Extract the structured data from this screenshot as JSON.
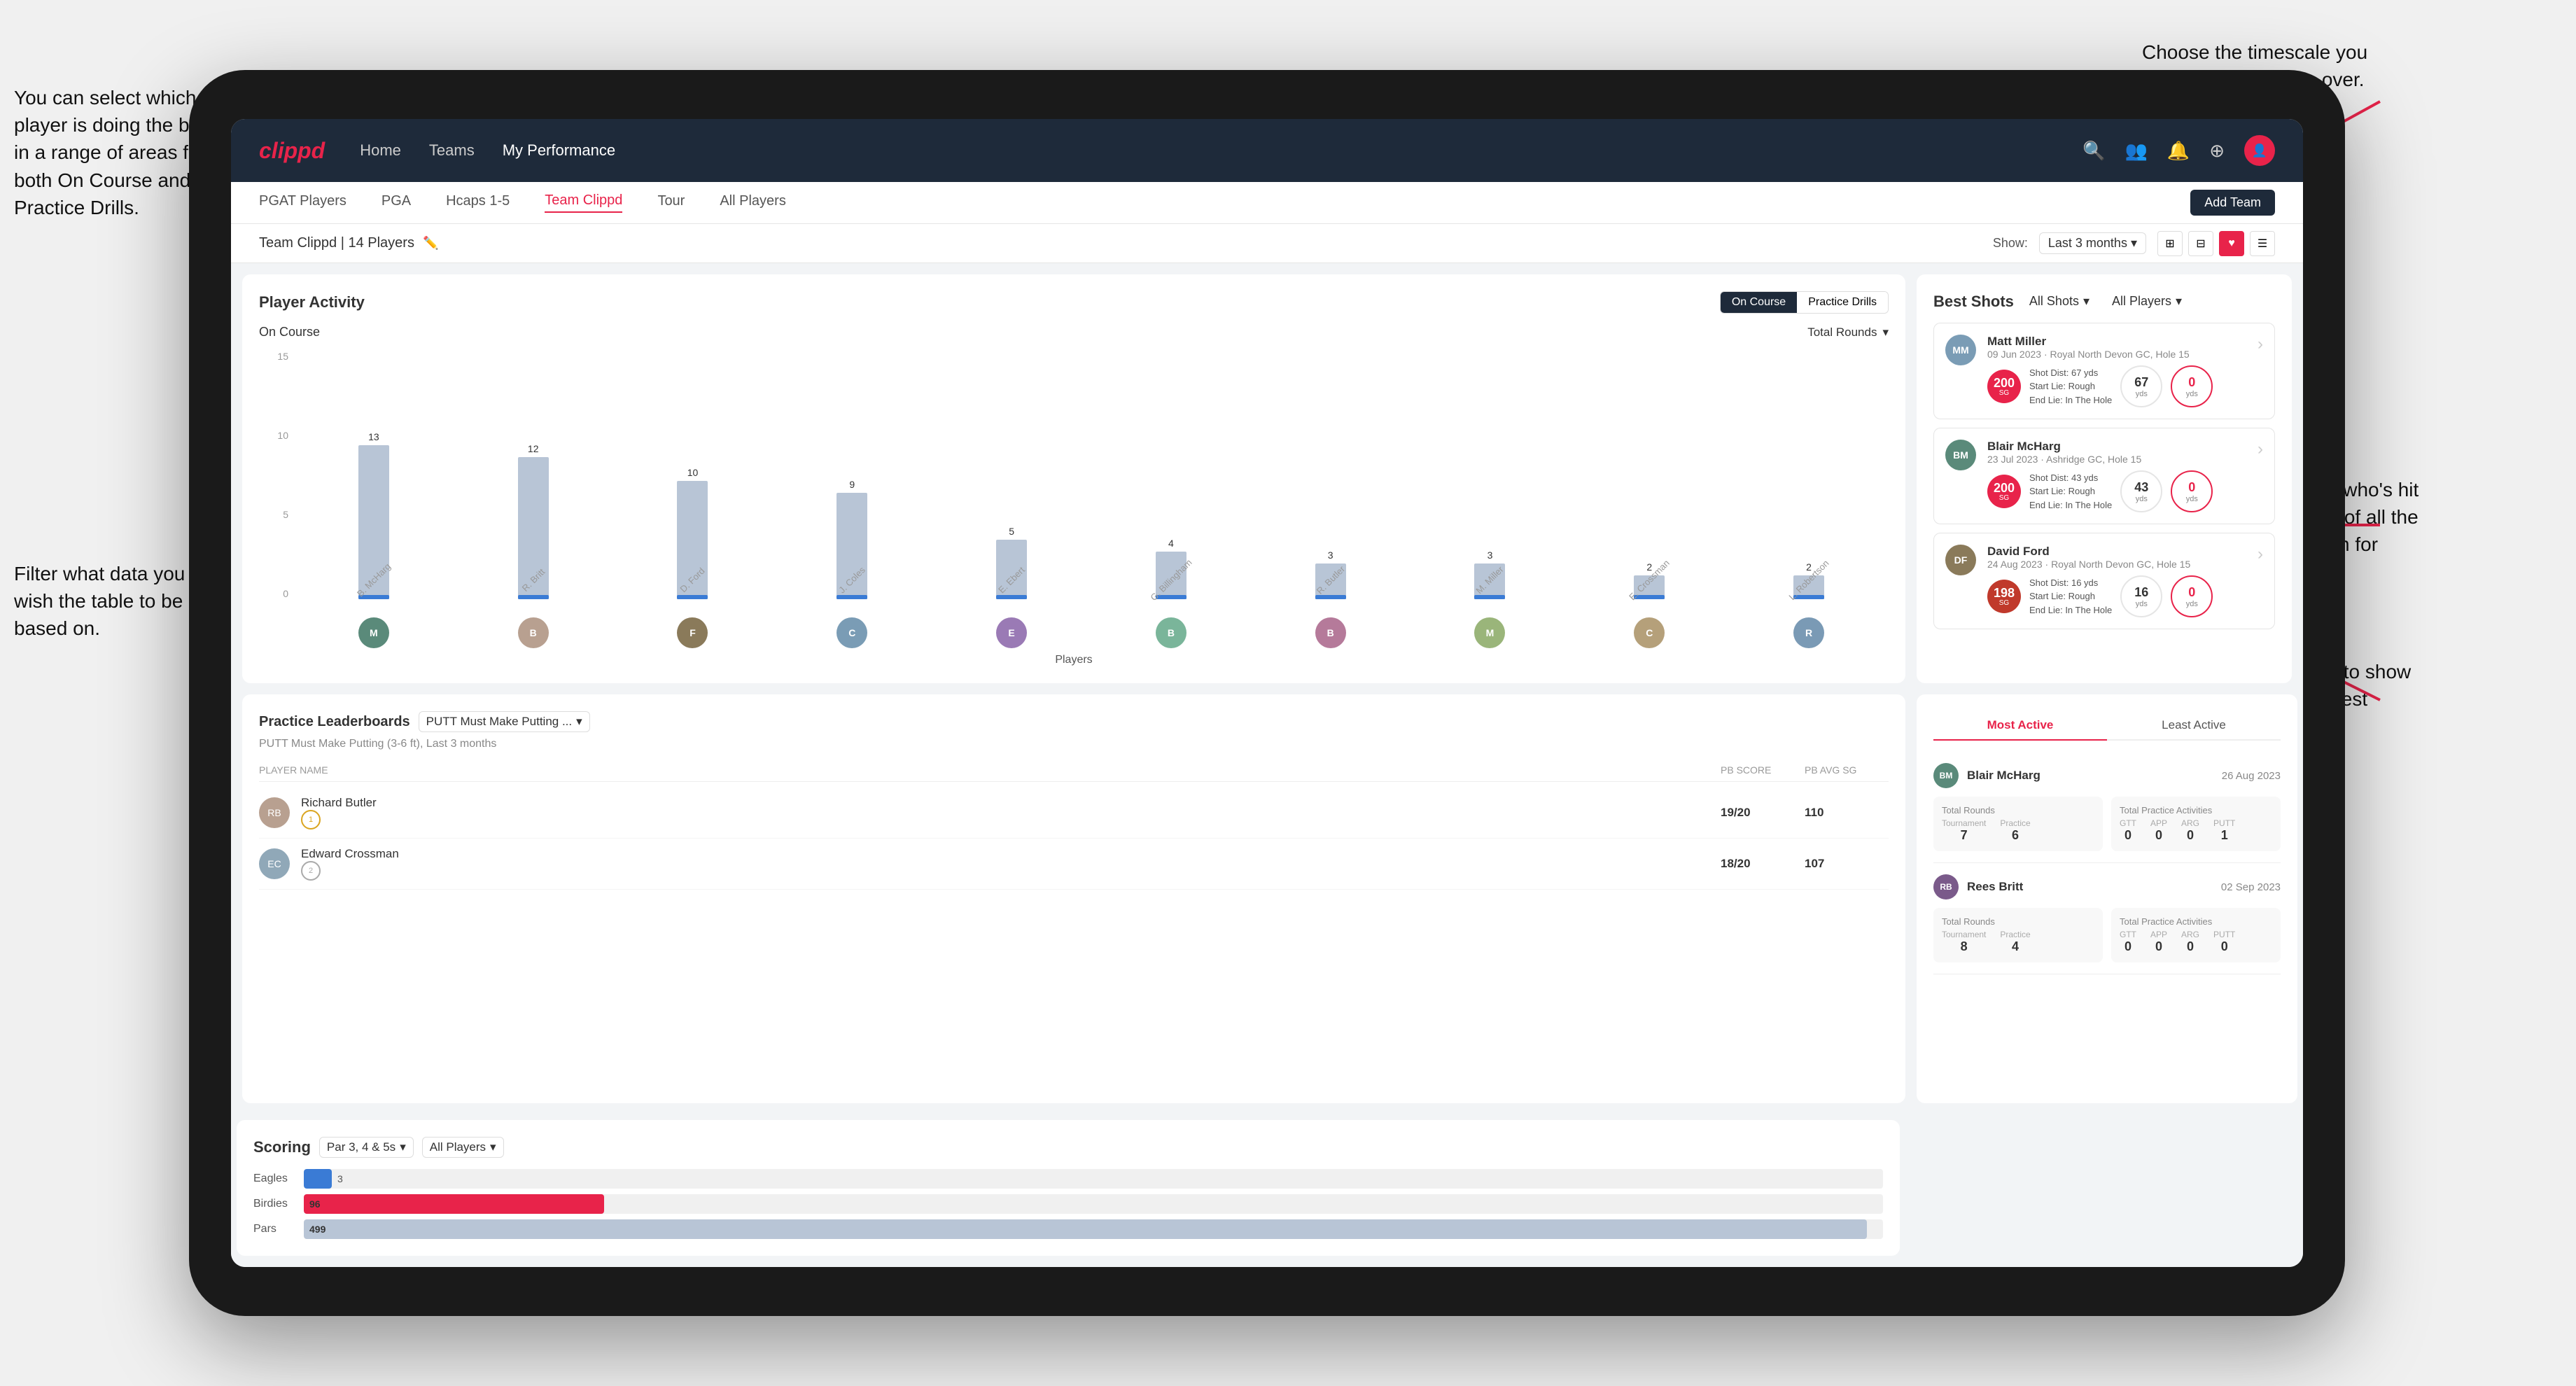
{
  "annotations": {
    "top_right": "Choose the timescale you wish to see the data over.",
    "left_top": "You can select which player is doing the best in a range of areas for both On Course and Practice Drills.",
    "left_bottom": "Filter what data you wish the table to be based on.",
    "right_mid": "Here you can see who's hit the best shots out of all the players in the team for each department.",
    "right_bottom": "You can also filter to show just one player's best shots."
  },
  "nav": {
    "logo": "clippd",
    "items": [
      "Home",
      "Teams",
      "My Performance"
    ],
    "icons": [
      "🔍",
      "👤",
      "🔔",
      "⊕",
      "👤"
    ]
  },
  "sub_nav": {
    "items": [
      "PGAT Players",
      "PGA",
      "Hcaps 1-5",
      "Team Clippd",
      "Tour",
      "All Players"
    ],
    "active": "Team Clippd",
    "add_button": "Add Team"
  },
  "team_header": {
    "title": "Team Clippd | 14 Players",
    "show_label": "Show:",
    "show_value": "Last 3 months",
    "view_icons": [
      "grid4",
      "grid2",
      "heart",
      "list"
    ]
  },
  "player_activity": {
    "title": "Player Activity",
    "toggle_options": [
      "On Course",
      "Practice Drills"
    ],
    "active_toggle": "On Course",
    "section_label": "On Course",
    "dropdown_label": "Total Rounds",
    "y_labels": [
      "0",
      "5",
      "10",
      "15"
    ],
    "y_axis_title": "Total Rounds",
    "bars": [
      {
        "player": "B. McHarg",
        "value": 13,
        "color": "#b8c5d6"
      },
      {
        "player": "R. Britt",
        "value": 12,
        "color": "#b8c5d6"
      },
      {
        "player": "D. Ford",
        "value": 10,
        "color": "#b8c5d6"
      },
      {
        "player": "J. Coles",
        "value": 9,
        "color": "#b8c5d6"
      },
      {
        "player": "E. Ebert",
        "value": 5,
        "color": "#b8c5d6"
      },
      {
        "player": "G. Billingham",
        "value": 4,
        "color": "#b8c5d6"
      },
      {
        "player": "R. Butler",
        "value": 3,
        "color": "#b8c5d6"
      },
      {
        "player": "M. Miller",
        "value": 3,
        "color": "#b8c5d6"
      },
      {
        "player": "E. Crossman",
        "value": 2,
        "color": "#b8c5d6"
      },
      {
        "player": "L. Robertson",
        "value": 2,
        "color": "#b8c5d6"
      }
    ],
    "x_axis_title": "Players"
  },
  "best_shots": {
    "title": "Best Shots",
    "filters": [
      "All Shots",
      "All Players"
    ],
    "players": [
      {
        "name": "Matt Miller",
        "date": "09 Jun 2023",
        "course": "Royal North Devon GC",
        "hole": "Hole 15",
        "badge_num": "200",
        "badge_label": "SG",
        "shot_dist": "67 yds",
        "start_lie": "Rough",
        "end_lie": "In The Hole",
        "stat1_val": "67",
        "stat1_unit": "yds",
        "stat2_val": "0",
        "stat2_unit": "yds"
      },
      {
        "name": "Blair McHarg",
        "date": "23 Jul 2023",
        "course": "Ashridge GC",
        "hole": "Hole 15",
        "badge_num": "200",
        "badge_label": "SG",
        "shot_dist": "43 yds",
        "start_lie": "Rough",
        "end_lie": "In The Hole",
        "stat1_val": "43",
        "stat1_unit": "yds",
        "stat2_val": "0",
        "stat2_unit": "yds"
      },
      {
        "name": "David Ford",
        "date": "24 Aug 2023",
        "course": "Royal North Devon GC",
        "hole": "Hole 15",
        "badge_num": "198",
        "badge_label": "SG",
        "shot_dist": "16 yds",
        "start_lie": "Rough",
        "end_lie": "In The Hole",
        "stat1_val": "16",
        "stat1_unit": "yds",
        "stat2_val": "0",
        "stat2_unit": "yds"
      }
    ]
  },
  "practice_leaderboards": {
    "title": "Practice Leaderboards",
    "drill_label": "PUTT Must Make Putting ...",
    "sub_label": "PUTT Must Make Putting (3-6 ft), Last 3 months",
    "columns": [
      "PLAYER NAME",
      "PB SCORE",
      "PB AVG SG"
    ],
    "players": [
      {
        "rank": 1,
        "rank_type": "gold",
        "name": "Richard Butler",
        "score": "19/20",
        "avg_sg": "110"
      },
      {
        "rank": 2,
        "rank_type": "silver",
        "name": "Edward Crossman",
        "score": "18/20",
        "avg_sg": "107"
      }
    ]
  },
  "most_active": {
    "tabs": [
      "Most Active",
      "Least Active"
    ],
    "active_tab": "Most Active",
    "players": [
      {
        "name": "Blair McHarg",
        "date": "26 Aug 2023",
        "total_rounds_label": "Total Rounds",
        "tournament": "7",
        "practice": "6",
        "total_practice_label": "Total Practice Activities",
        "gtt": "0",
        "app": "0",
        "arg": "0",
        "putt": "1"
      },
      {
        "name": "Rees Britt",
        "date": "02 Sep 2023",
        "total_rounds_label": "Total Rounds",
        "tournament": "8",
        "practice": "4",
        "total_practice_label": "Total Practice Activities",
        "gtt": "0",
        "app": "0",
        "arg": "0",
        "putt": "0"
      }
    ]
  },
  "scoring": {
    "title": "Scoring",
    "filter1": "Par 3, 4 & 5s",
    "filter2": "All Players",
    "rows": [
      {
        "label": "Eagles",
        "value": 3,
        "max": 500,
        "color": "#3a7bd5"
      },
      {
        "label": "Birdies",
        "value": 96,
        "max": 500,
        "color": "#e8234a"
      },
      {
        "label": "Pars",
        "value": 499,
        "max": 500,
        "color": "#b8c5d6"
      }
    ]
  }
}
